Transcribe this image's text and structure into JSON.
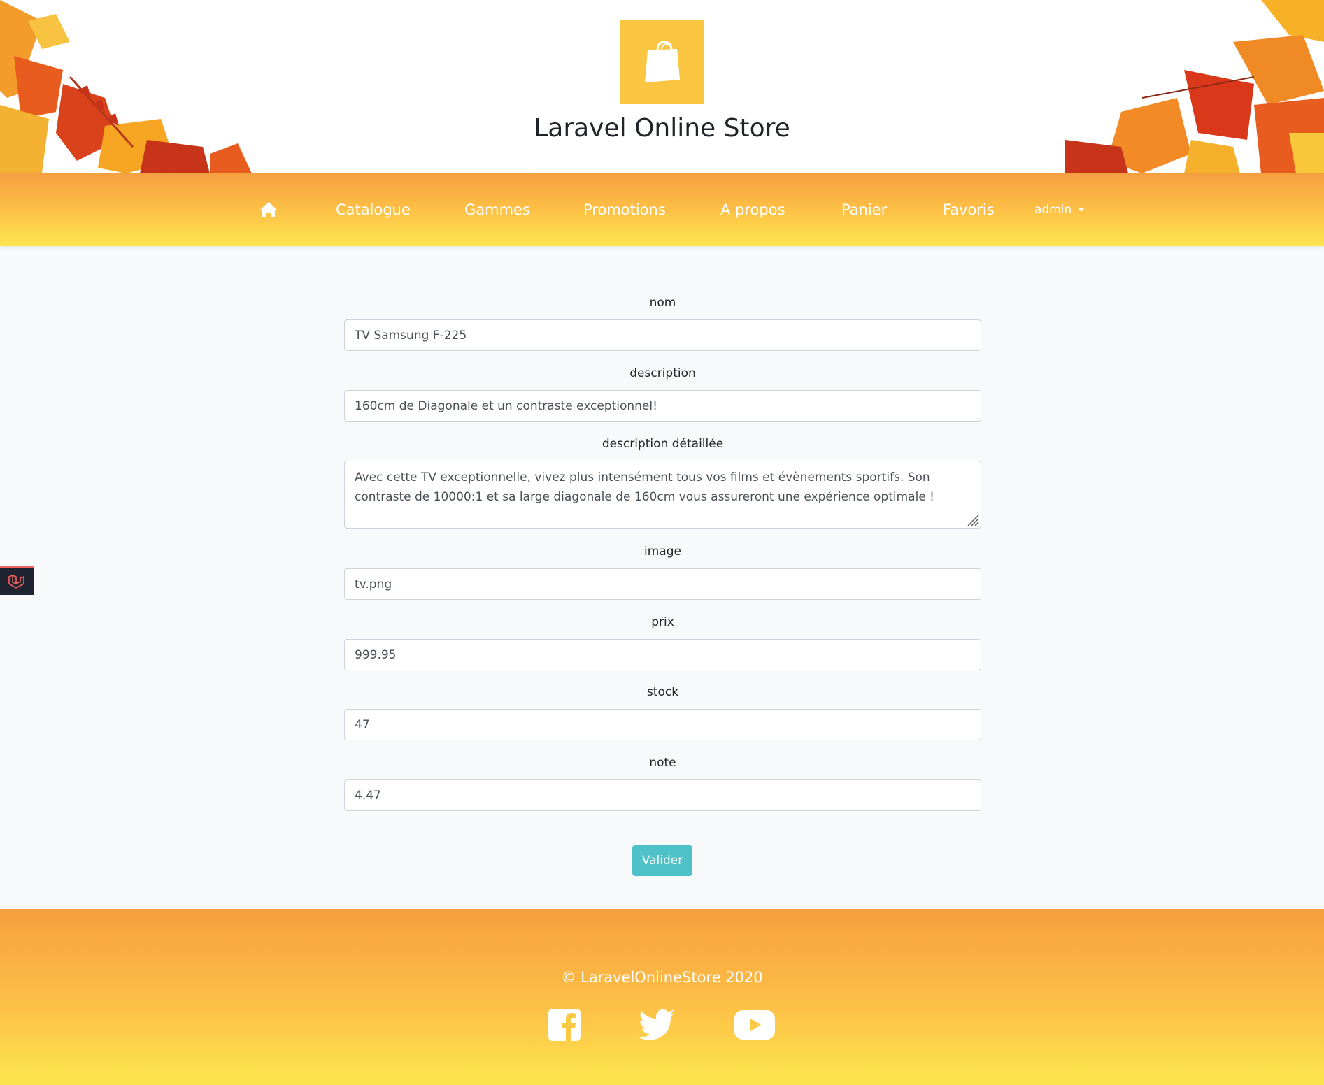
{
  "header": {
    "site_title": "Laravel Online Store",
    "logo_icon": "shopping-bag-icon",
    "logo_color": "#fac642"
  },
  "navbar": {
    "home_icon": "home-icon",
    "items": [
      {
        "label": "Catalogue"
      },
      {
        "label": "Gammes"
      },
      {
        "label": "Promotions"
      },
      {
        "label": "A propos"
      },
      {
        "label": "Panier"
      },
      {
        "label": "Favoris"
      }
    ],
    "user_menu": {
      "label": "admin"
    }
  },
  "form": {
    "fields": [
      {
        "label": "nom",
        "value": "TV Samsung F-225"
      },
      {
        "label": "description",
        "value": "160cm de Diagonale et un contraste exceptionnel!"
      },
      {
        "label": "description détaillée",
        "value": "Avec cette TV exceptionnelle, vivez plus intensément tous vos films et évènements sportifs. Son contraste de 10000:1 et sa large diagonale de 160cm vous assureront une expérience optimale !"
      },
      {
        "label": "image",
        "value": "tv.png"
      },
      {
        "label": "prix",
        "value": "999.95"
      },
      {
        "label": "stock",
        "value": "47"
      },
      {
        "label": "note",
        "value": "4.47"
      }
    ],
    "submit_label": "Valider",
    "submit_color": "#4fc1c9"
  },
  "footer": {
    "copyright": "© LaravelOnlineStore 2020",
    "social": [
      {
        "icon": "facebook-icon"
      },
      {
        "icon": "twitter-icon"
      },
      {
        "icon": "youtube-icon"
      }
    ]
  },
  "colors": {
    "nav_gradient_top": "#f59f3f",
    "nav_gradient_bottom": "#fde54f",
    "debug_tab_accent": "#f4645f"
  }
}
